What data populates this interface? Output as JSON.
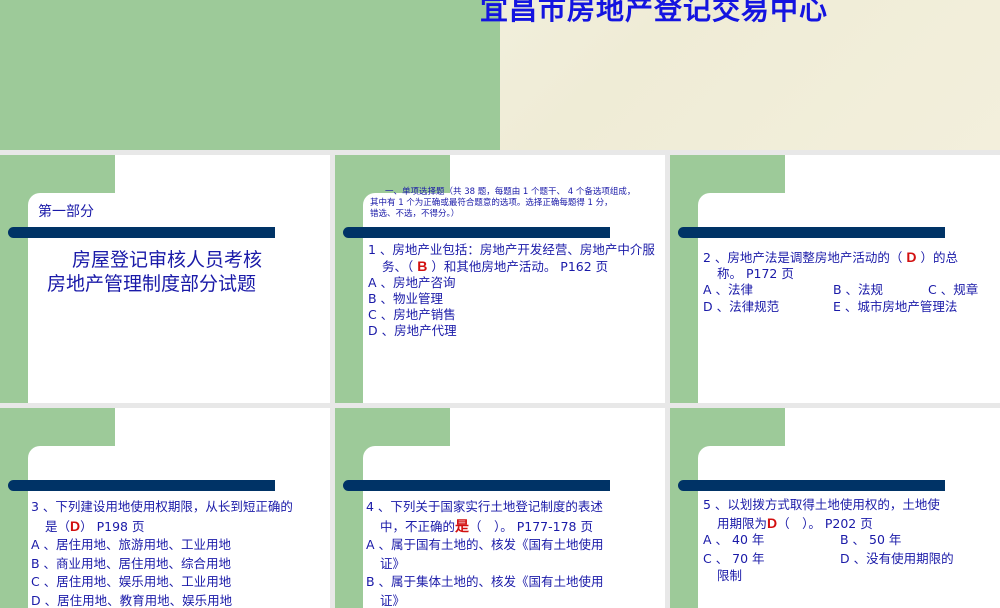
{
  "header": {
    "title": "宜昌市房地产登记交易中心"
  },
  "slides": [
    {
      "part": "第一部分",
      "title_line1": "房屋登记审核人员考核",
      "title_line2": "房地产管理制度部分试题"
    },
    {
      "intro_line1": "一、单项选择题（共 38 题，每题由 1 个题干、 4 个备选项组成，",
      "intro_line2": "其中有 1 个为正确或最符合题意的选项。选择正确每题得 1 分，",
      "intro_line3": "错选、不选，不得分。）",
      "q_line1": "1 、房地产业包括：房地产开发经营、房地产中介服",
      "q_pre": "务、（ ",
      "answer": "B",
      "q_post": " ）和其他房地产活动。 P162 页",
      "options": [
        "A 、房地产咨询",
        "B 、物业管理",
        "C 、房地产销售",
        "D 、房地产代理"
      ]
    },
    {
      "q_pre": "2 、房地产法是调整房地产活动的（ ",
      "answer": "D",
      "q_post": " ）的总",
      "q_line2": "称。 P172 页",
      "options": [
        "A 、法律",
        "B 、法规",
        "C 、规章",
        "D 、法律规范",
        "E 、城市房地产管理法"
      ]
    },
    {
      "q_line1": "3 、下列建设用地使用权期限，从长到短正确的",
      "q_pre": "是（",
      "answer": "D",
      "q_post": "） P198 页",
      "options": [
        "A 、居住用地、旅游用地、工业用地",
        "B 、商业用地、居住用地、综合用地",
        "C 、居住用地、娱乐用地、工业用地",
        "D 、居住用地、教育用地、娱乐用地"
      ]
    },
    {
      "q_line1": "4 、下列关于国家实行土地登记制度的表述",
      "q_pre": "中，不正确的",
      "answer": "是",
      "q_post": "（　）。 P177-178 页",
      "options": [
        "A 、属于国有土地的、核发《国有土地使用",
        "证》",
        "B 、属于集体土地的、核发《国有土地使用",
        "证》"
      ]
    },
    {
      "q_line1": "5 、以划拨方式取得土地使用权的，土地使",
      "q_pre": "用期限为",
      "answer": "D",
      "q_post": "（　）。 P202 页",
      "options": [
        "A 、 40 年",
        "B 、 50 年",
        "C 、 70 年",
        "D 、没有使用期限的",
        "限制"
      ]
    }
  ]
}
